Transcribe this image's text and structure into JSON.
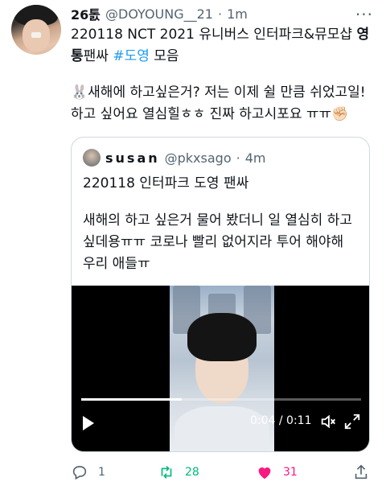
{
  "tweet": {
    "author_name": "26톬",
    "handle": "@DOYOUNG__21",
    "separator": "·",
    "time": "1m",
    "more_label": "···",
    "line1_a": "220118 NCT 2021 유니버스 인터파크&뮤모샵 ",
    "line1_bold": "영",
    "line2_bold": "통",
    "line2_a": "팬싸 ",
    "hashtag": "#도영",
    "line2_b": " 모음",
    "emoji_rabbit": "🐰",
    "body_line1": "새해에 하고싶은거? 저는 이제 쉴 만큼 쉬었고일!",
    "body_line2": "하고 싶어요 열심힐ㅎㅎ 진짜 하고시포요 ㅠㅠ",
    "emoji_fist": "✊🏻"
  },
  "quote": {
    "name": "susan",
    "handle": "@pkxsago",
    "separator": "·",
    "time": "4m",
    "title": "220118 인터파크 도영 팬싸",
    "body_line1": "새해의 하고 싶은거 물어 봤더니 일 열심히 하고",
    "body_line2": "싶데용ㅠㅠ 코로나 빨리 없어지라 투어 해야해",
    "body_line3": "우리 애들ㅠ"
  },
  "video": {
    "time_display": "0:04 / 0:11",
    "progress": 0.36
  },
  "actions": {
    "reply_count": "1",
    "retweet_count": "28",
    "like_count": "31"
  },
  "colors": {
    "accent": "#1d9bf0",
    "retweet": "#00ba7c",
    "like": "#f91880",
    "muted": "#536471"
  }
}
